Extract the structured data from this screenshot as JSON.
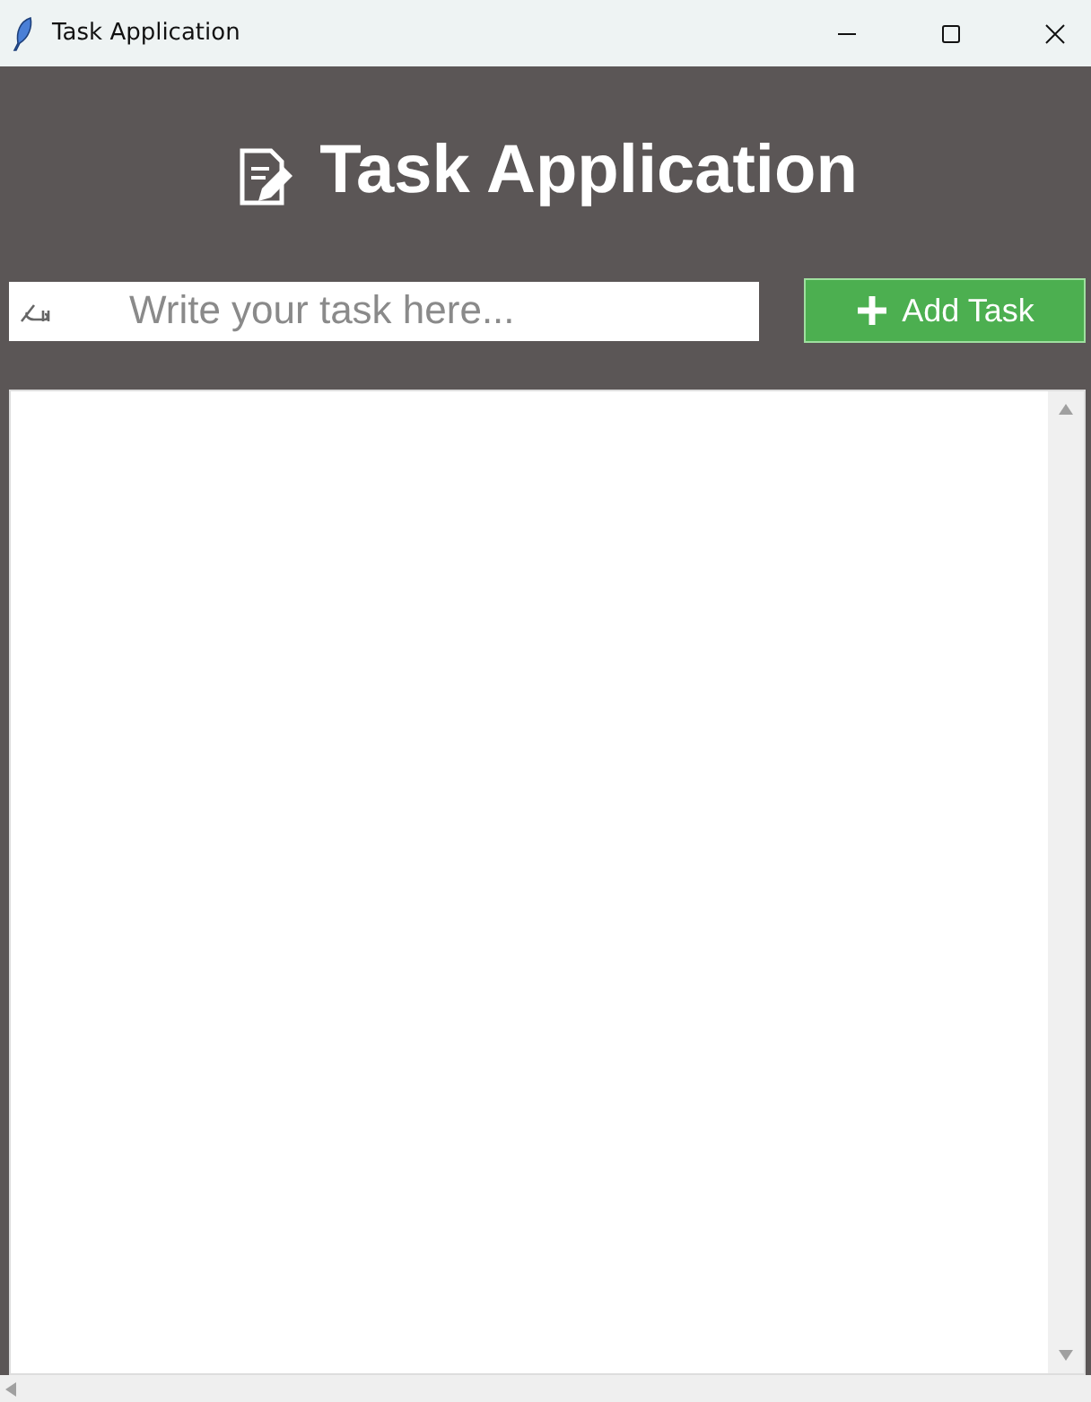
{
  "window": {
    "title": "Task Application"
  },
  "header": {
    "title": "Task Application"
  },
  "task_input": {
    "placeholder": "Write your task here..."
  },
  "add_button": {
    "label": "Add Task"
  }
}
